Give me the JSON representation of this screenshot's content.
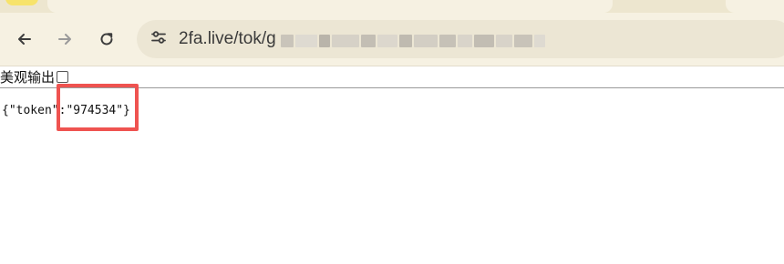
{
  "browser": {
    "url_visible": "2fa.live/tok/g",
    "back_icon": "arrow-left-icon",
    "forward_icon": "arrow-right-icon",
    "reload_icon": "reload-icon",
    "site_info_icon": "tune-icon"
  },
  "page": {
    "toggle_label": "美观输出",
    "toggle_checked": false,
    "json_output": "{\"token\":\"974534\"}"
  },
  "annotation": {
    "highlight_color": "#ef5350"
  }
}
